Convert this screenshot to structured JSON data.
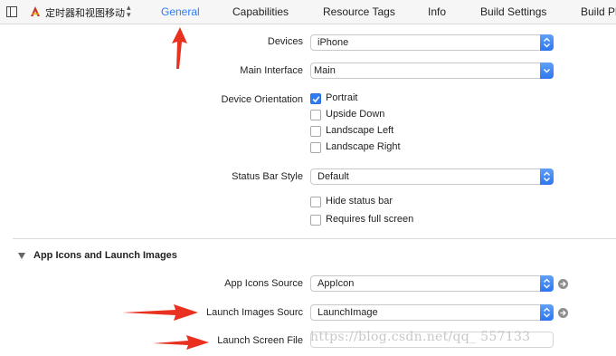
{
  "topbar": {
    "target_name": "定时器和视图移动",
    "tabs": [
      {
        "label": "General",
        "active": true
      },
      {
        "label": "Capabilities",
        "active": false
      },
      {
        "label": "Resource Tags",
        "active": false
      },
      {
        "label": "Info",
        "active": false
      },
      {
        "label": "Build Settings",
        "active": false
      },
      {
        "label": "Build Ph",
        "active": false
      }
    ]
  },
  "deployment": {
    "devices_label": "Devices",
    "devices_value": "iPhone",
    "main_interface_label": "Main Interface",
    "main_interface_value": "Main",
    "orientation_label": "Device Orientation",
    "orientations": [
      {
        "label": "Portrait",
        "checked": true
      },
      {
        "label": "Upside Down",
        "checked": false
      },
      {
        "label": "Landscape Left",
        "checked": false
      },
      {
        "label": "Landscape Right",
        "checked": false
      }
    ],
    "status_bar_style_label": "Status Bar Style",
    "status_bar_style_value": "Default",
    "hide_status_bar": {
      "label": "Hide status bar",
      "checked": false
    },
    "requires_full_screen": {
      "label": "Requires full screen",
      "checked": false
    }
  },
  "app_icons": {
    "section_title": "App Icons and Launch Images",
    "app_icons_source_label": "App Icons Source",
    "app_icons_source_value": "AppIcon",
    "launch_images_source_label": "Launch Images Sourc",
    "launch_images_source_value": "LaunchImage",
    "launch_screen_file_label": "Launch Screen File",
    "launch_screen_file_value": ""
  },
  "watermark": "https://blog.csdn.net/qq_  557133",
  "colors": {
    "accent": "#2f7cf6",
    "annotation_arrow": "#e8321f"
  }
}
